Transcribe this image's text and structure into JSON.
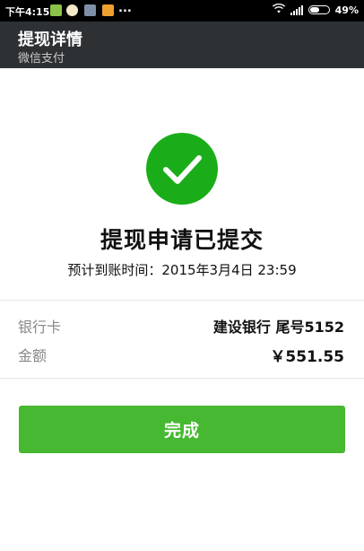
{
  "status_bar": {
    "time": "下午4:15",
    "more": "...",
    "battery_percent": "49%",
    "icons": [
      "wifi-icon",
      "signal-icon",
      "battery-icon"
    ]
  },
  "header": {
    "title": "提现详情",
    "subtitle": "微信支付"
  },
  "result": {
    "icon": "checkmark-icon",
    "heading": "提现申请已提交",
    "eta": "预计到账时间：2015年3月4日 23:59"
  },
  "details": {
    "bank_label": "银行卡",
    "bank_value": "建设银行 尾号5152",
    "amount_label": "金额",
    "amount_value": "￥551.55"
  },
  "actions": {
    "done_label": "完成"
  },
  "colors": {
    "accent": "#1aad19",
    "button": "#47b832",
    "header_bg": "#2e3134",
    "status_bg": "#000000"
  }
}
